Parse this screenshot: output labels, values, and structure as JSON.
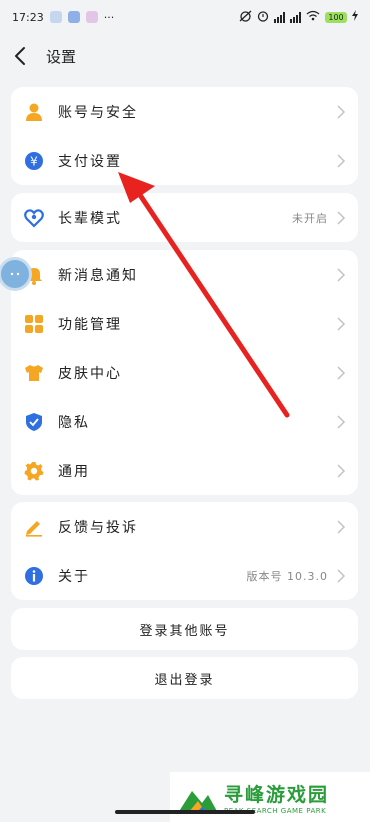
{
  "status_bar": {
    "time": "17:23",
    "more": "···",
    "battery": "100"
  },
  "header": {
    "title": "设置"
  },
  "groups": [
    {
      "items": [
        {
          "label": "账号与安全",
          "icon": "person-icon",
          "color": "#f5a623"
        },
        {
          "label": "支付设置",
          "icon": "yuan-icon",
          "color": "#2f6fe0"
        }
      ]
    },
    {
      "items": [
        {
          "label": "长辈模式",
          "icon": "heart-icon",
          "color": "#2f6fe0",
          "value": "未开启"
        }
      ]
    },
    {
      "items": [
        {
          "label": "新消息通知",
          "icon": "bell-icon",
          "color": "#f5a623"
        },
        {
          "label": "功能管理",
          "icon": "grid-icon",
          "color": "#f5a623"
        },
        {
          "label": "皮肤中心",
          "icon": "shirt-icon",
          "color": "#f5a623"
        },
        {
          "label": "隐私",
          "icon": "shield-icon",
          "color": "#2f6fe0"
        },
        {
          "label": "通用",
          "icon": "gear-icon",
          "color": "#f5a623"
        }
      ]
    },
    {
      "items": [
        {
          "label": "反馈与投诉",
          "icon": "pencil-icon",
          "color": "#f5a623"
        },
        {
          "label": "关于",
          "icon": "info-icon",
          "color": "#2f6fe0",
          "value": "版本号 10.3.0"
        }
      ]
    }
  ],
  "actions": {
    "login_other": "登录其他账号",
    "logout": "退出登录"
  },
  "watermark": {
    "title": "寻峰游戏园",
    "subtitle": "PEAK SEARCH GAME PARK"
  },
  "annotation": {
    "arrow_color": "#e8231f"
  }
}
